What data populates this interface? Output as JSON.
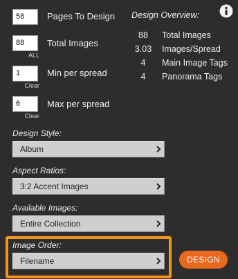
{
  "inputs": {
    "pages": {
      "value": "58",
      "label": "Pages To Design"
    },
    "total_images": {
      "value": "88",
      "label": "Total Images",
      "link": "ALL"
    },
    "min_per_spread": {
      "value": "1",
      "label": "Min per spread",
      "link": "Clear"
    },
    "max_per_spread": {
      "value": "6",
      "label": "Max per spread",
      "link": "Clear"
    }
  },
  "overview": {
    "title": "Design Overview:",
    "rows": [
      {
        "value": "88",
        "label": "Total Images"
      },
      {
        "value": "3.03",
        "label": "Images/Spread"
      },
      {
        "value": "4",
        "label": "Main Image Tags"
      },
      {
        "value": "4",
        "label": "Panorama Tags"
      }
    ]
  },
  "sections": {
    "design_style": {
      "label": "Design Style:",
      "value": "Album"
    },
    "aspect_ratios": {
      "label": "Aspect Ratios:",
      "value": "3:2 Accent Images"
    },
    "available_images": {
      "label": "Available Images:",
      "value": "Entire Collection"
    },
    "image_order": {
      "label": "Image Order:",
      "value": "Filename"
    }
  },
  "design_button": {
    "label": "DESIGN"
  },
  "icons": {
    "info": "info-icon",
    "chevron": "chevron-right-icon"
  },
  "colors": {
    "background": "#2d2d2d",
    "dropdown": "#cfcfcf",
    "accent": "#e8681e",
    "highlight": "#f7941d"
  }
}
